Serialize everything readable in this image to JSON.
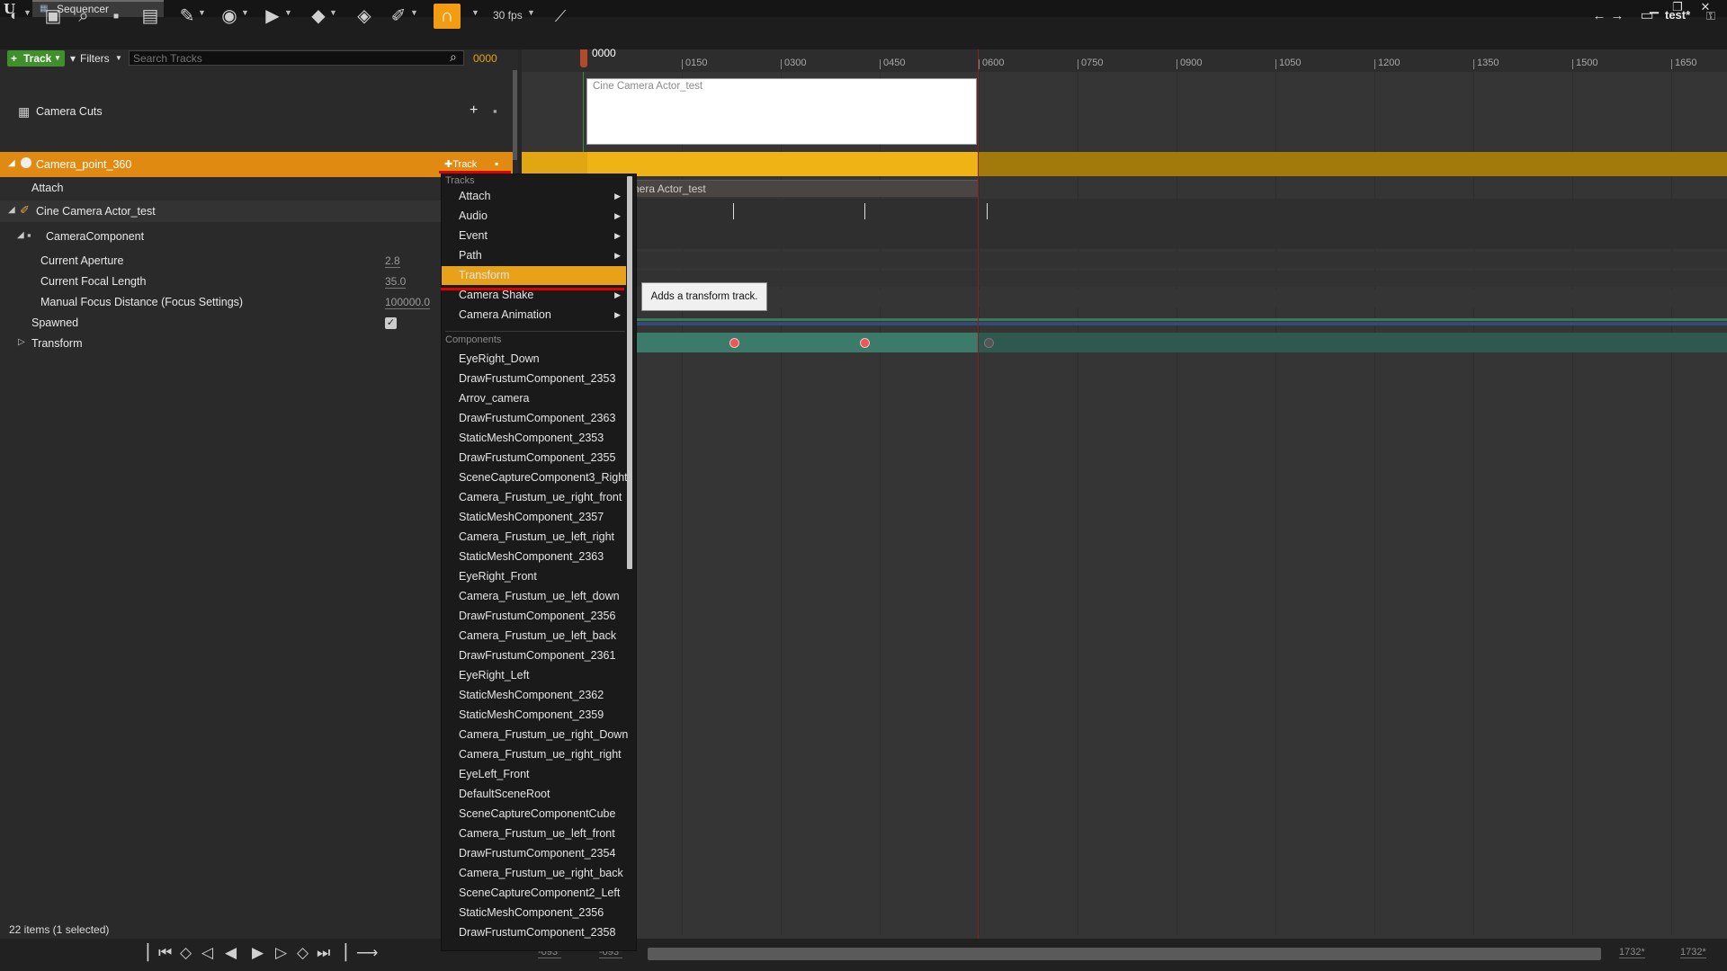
{
  "window": {
    "tab_title": "Sequencer",
    "project_label": "test*",
    "fps_label": "30 fps",
    "icons": [
      "unreal-logo",
      "save-icon",
      "search-icon",
      "camera-icon",
      "clapper-icon",
      "wrench-icon",
      "eye-icon",
      "play-icon",
      "diamond-icon",
      "key-icon",
      "pencil-icon",
      "magnet-icon",
      "curve-icon",
      "back-arrow-icon",
      "forward-arrow-icon",
      "folder-icon",
      "lock-icon"
    ]
  },
  "tracks_panel": {
    "track_button": "Track",
    "filters_button": "Filters",
    "search_placeholder": "Search Tracks",
    "frame_value": "0000",
    "camera_cuts": "Camera Cuts",
    "camera_point": "Camera_point_360",
    "camera_point_track_btn": "Track",
    "attach": "Attach",
    "cine_actor": "Cine Camera Actor_test",
    "camera_component": "CameraComponent",
    "properties": [
      {
        "label": "Current Aperture",
        "value": "2.8"
      },
      {
        "label": "Current Focal Length",
        "value": "35.0"
      },
      {
        "label": "Manual Focus Distance (Focus Settings)",
        "value": "100000.0"
      }
    ],
    "spawned": "Spawned",
    "transform": "Transform",
    "status": "22 items (1 selected)"
  },
  "timeline": {
    "playhead": "0000",
    "ticks": [
      "0150",
      "0300",
      "0450",
      "0600",
      "0750",
      "0900",
      "1050",
      "1200",
      "1350",
      "1500",
      "1650"
    ],
    "camera_cut_section": "Cine Camera Actor_test",
    "attach_section": "nera Actor_test",
    "range_start_a": "-093*",
    "range_start_b": "-093*",
    "range_end_a": "1732*",
    "range_end_b": "1732*"
  },
  "menu": {
    "tracks_header": "Tracks",
    "tracks": [
      {
        "label": "Attach",
        "submenu": true
      },
      {
        "label": "Audio",
        "submenu": true
      },
      {
        "label": "Event",
        "submenu": true
      },
      {
        "label": "Path",
        "submenu": true
      },
      {
        "label": "Transform",
        "submenu": false,
        "highlighted": true
      },
      {
        "label": "Camera Shake",
        "submenu": true
      },
      {
        "label": "Camera Animation",
        "submenu": true
      }
    ],
    "components_header": "Components",
    "components": [
      "EyeRight_Down",
      "DrawFrustumComponent_2353",
      "Arrov_camera",
      "DrawFrustumComponent_2363",
      "StaticMeshComponent_2353",
      "DrawFrustumComponent_2355",
      "SceneCaptureComponent3_Right",
      "Camera_Frustum_ue_right_front",
      "StaticMeshComponent_2357",
      "Camera_Frustum_ue_left_right",
      "StaticMeshComponent_2363",
      "EyeRight_Front",
      "Camera_Frustum_ue_left_down",
      "DrawFrustumComponent_2356",
      "Camera_Frustum_ue_left_back",
      "DrawFrustumComponent_2361",
      "EyeRight_Left",
      "StaticMeshComponent_2362",
      "StaticMeshComponent_2359",
      "Camera_Frustum_ue_right_Down",
      "Camera_Frustum_ue_right_right",
      "EyeLeft_Front",
      "DefaultSceneRoot",
      "SceneCaptureComponentCube",
      "Camera_Frustum_ue_left_front",
      "DrawFrustumComponent_2354",
      "Camera_Frustum_ue_right_back",
      "SceneCaptureComponent2_Left",
      "StaticMeshComponent_2356",
      "DrawFrustumComponent_2358"
    ],
    "tooltip": "Adds a transform track."
  },
  "colors": {
    "accent_orange": "#e08a12",
    "highlight": "#e8a21a",
    "add_track_green": "#3f8f2b"
  }
}
